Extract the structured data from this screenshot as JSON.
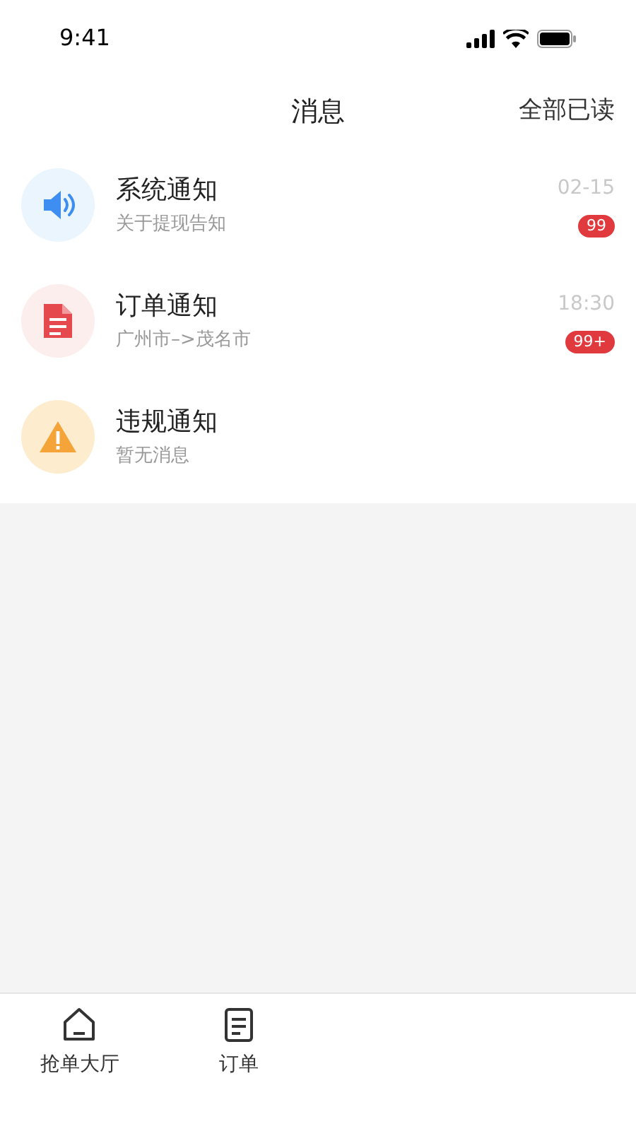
{
  "status_bar": {
    "time": "9:41"
  },
  "header": {
    "title": "消息",
    "action": "全部已读"
  },
  "messages": [
    {
      "kind": "system",
      "title": "系统通知",
      "subtitle": "关于提现告知",
      "time": "02-15",
      "badge": "99"
    },
    {
      "kind": "order",
      "title": "订单通知",
      "subtitle": "广州市–>茂名市",
      "time": "18:30",
      "badge": "99+"
    },
    {
      "kind": "violation",
      "title": "违规通知",
      "subtitle": "暂无消息"
    }
  ],
  "tab_bar": [
    {
      "kind": "home",
      "label": "抢单大厅"
    },
    {
      "kind": "orders",
      "label": "订单"
    }
  ]
}
